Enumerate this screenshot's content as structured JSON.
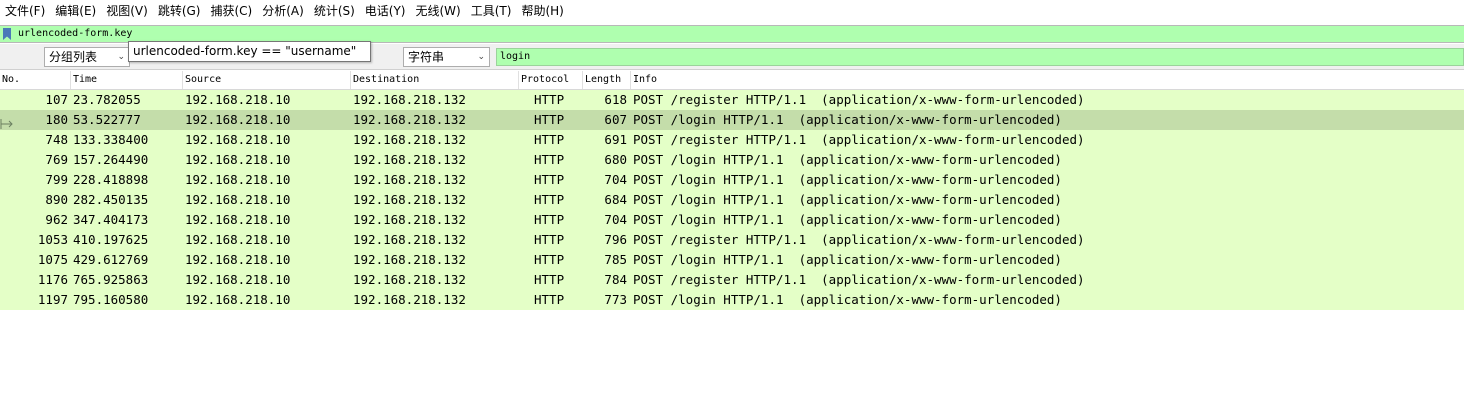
{
  "menu": [
    "文件(F)",
    "编辑(E)",
    "视图(V)",
    "跳转(G)",
    "捕获(C)",
    "分析(A)",
    "统计(S)",
    "电话(Y)",
    "无线(W)",
    "工具(T)",
    "帮助(H)"
  ],
  "filter": {
    "value": "urlencoded-form.key"
  },
  "tooltip": {
    "text": "urlencoded-form.key == \"username\""
  },
  "find": {
    "scope": "分组列表",
    "type": "字符串",
    "search_value": "login"
  },
  "columns": [
    "No.",
    "Time",
    "Source",
    "Destination",
    "Protocol",
    "Length",
    "Info"
  ],
  "packets": [
    {
      "no": "107",
      "time": "23.782055",
      "src": "192.168.218.10",
      "dst": "192.168.218.132",
      "proto": "HTTP",
      "len": "618",
      "info": "POST /register HTTP/1.1  (application/x-www-form-urlencoded)"
    },
    {
      "no": "180",
      "time": "53.522777",
      "src": "192.168.218.10",
      "dst": "192.168.218.132",
      "proto": "HTTP",
      "len": "607",
      "info": "POST /login HTTP/1.1  (application/x-www-form-urlencoded)"
    },
    {
      "no": "748",
      "time": "133.338400",
      "src": "192.168.218.10",
      "dst": "192.168.218.132",
      "proto": "HTTP",
      "len": "691",
      "info": "POST /register HTTP/1.1  (application/x-www-form-urlencoded)"
    },
    {
      "no": "769",
      "time": "157.264490",
      "src": "192.168.218.10",
      "dst": "192.168.218.132",
      "proto": "HTTP",
      "len": "680",
      "info": "POST /login HTTP/1.1  (application/x-www-form-urlencoded)"
    },
    {
      "no": "799",
      "time": "228.418898",
      "src": "192.168.218.10",
      "dst": "192.168.218.132",
      "proto": "HTTP",
      "len": "704",
      "info": "POST /login HTTP/1.1  (application/x-www-form-urlencoded)"
    },
    {
      "no": "890",
      "time": "282.450135",
      "src": "192.168.218.10",
      "dst": "192.168.218.132",
      "proto": "HTTP",
      "len": "684",
      "info": "POST /login HTTP/1.1  (application/x-www-form-urlencoded)"
    },
    {
      "no": "962",
      "time": "347.404173",
      "src": "192.168.218.10",
      "dst": "192.168.218.132",
      "proto": "HTTP",
      "len": "704",
      "info": "POST /login HTTP/1.1  (application/x-www-form-urlencoded)"
    },
    {
      "no": "1053",
      "time": "410.197625",
      "src": "192.168.218.10",
      "dst": "192.168.218.132",
      "proto": "HTTP",
      "len": "796",
      "info": "POST /register HTTP/1.1  (application/x-www-form-urlencoded)"
    },
    {
      "no": "1075",
      "time": "429.612769",
      "src": "192.168.218.10",
      "dst": "192.168.218.132",
      "proto": "HTTP",
      "len": "785",
      "info": "POST /login HTTP/1.1  (application/x-www-form-urlencoded)"
    },
    {
      "no": "1176",
      "time": "765.925863",
      "src": "192.168.218.10",
      "dst": "192.168.218.132",
      "proto": "HTTP",
      "len": "784",
      "info": "POST /register HTTP/1.1  (application/x-www-form-urlencoded)"
    },
    {
      "no": "1197",
      "time": "795.160580",
      "src": "192.168.218.10",
      "dst": "192.168.218.132",
      "proto": "HTTP",
      "len": "773",
      "info": "POST /login HTTP/1.1  (application/x-www-form-urlencoded)"
    }
  ],
  "selected_index": 1,
  "colors": {
    "filter_bg": "#afffaf",
    "row_bg": "#e4ffc7",
    "row_selected_bg": "#c4ddaa"
  },
  "icons": {
    "bookmark": "bookmark-icon",
    "current_row": "current-packet-arrow-icon",
    "dropdown": "chevron-down-icon"
  }
}
